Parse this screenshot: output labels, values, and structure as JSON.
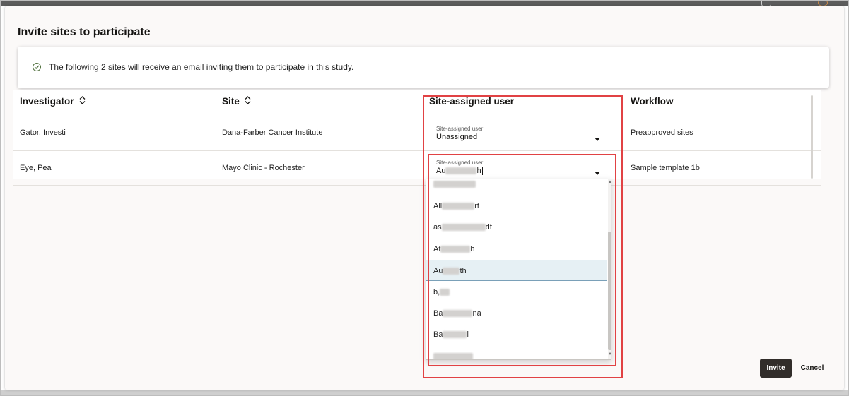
{
  "dialog": {
    "title": "Invite sites to participate",
    "banner_message": "The following 2 sites will receive an email inviting them to participate in this study."
  },
  "table": {
    "columns": [
      {
        "label": "Investigator",
        "sortable": true
      },
      {
        "label": "Site",
        "sortable": true
      },
      {
        "label": "Site-assigned user",
        "sortable": false
      },
      {
        "label": "Workflow",
        "sortable": false
      }
    ],
    "rows": [
      {
        "investigator": "Gator, Investi",
        "site": "Dana-Farber Cancer Institute",
        "user_label": "Site-assigned user",
        "user_value": "Unassigned",
        "workflow": "Preapproved sites"
      },
      {
        "investigator": "Eye, Pea",
        "site": "Mayo Clinic - Rochester",
        "user_label": "Site-assigned user",
        "user_value_prefix": "Au",
        "user_value_suffix": "h",
        "workflow": "Sample template 1b"
      }
    ]
  },
  "dropdown": {
    "options": [
      {
        "start": "All",
        "end": "rt"
      },
      {
        "start": "as",
        "end": "df"
      },
      {
        "start": "At",
        "end": "h"
      },
      {
        "start": "Au",
        "end": "th",
        "selected": true
      },
      {
        "start": "b,",
        "end": ""
      },
      {
        "start": "Ba",
        "end": "na"
      },
      {
        "start": "Ba",
        "end": "l"
      }
    ]
  },
  "actions": {
    "invite_label": "Invite",
    "cancel_label": "Cancel"
  },
  "colors": {
    "highlight_border": "#e14244",
    "primary_button": "#312d2a",
    "selected_option": "#e6f0f4",
    "success_icon": "#4f6f3c"
  },
  "icons": [
    "check-circle-icon",
    "sort-icon",
    "caret-down-icon"
  ]
}
